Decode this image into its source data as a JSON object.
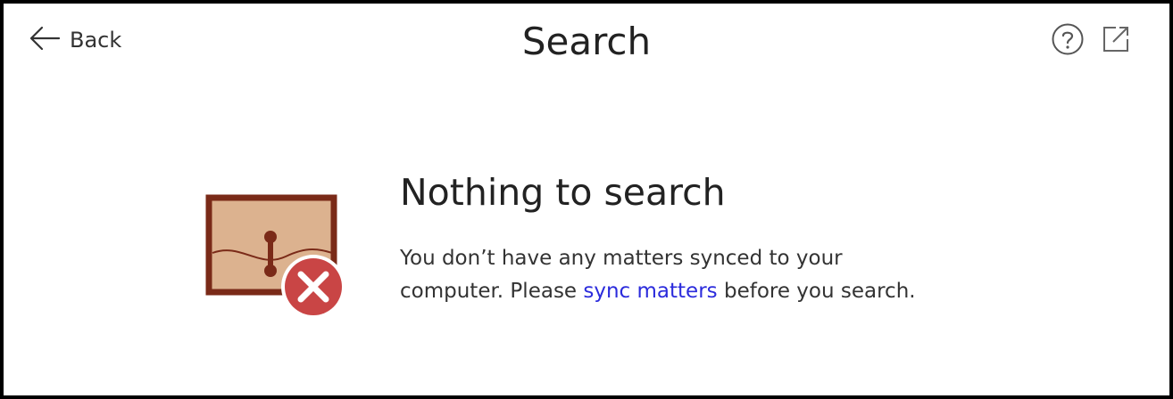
{
  "header": {
    "back_label": "Back",
    "title": "Search",
    "icons": [
      "help-icon",
      "open-external-icon"
    ]
  },
  "empty_state": {
    "heading": "Nothing to search",
    "message_line1": "You don’t have any matters synced to your",
    "message_line2_before": "computer. Please ",
    "link_text": "sync matters",
    "message_line2_after": " before you search.",
    "illustration": "briefcase-error-icon"
  },
  "colors": {
    "link": "#2b2bdc",
    "briefcase_border": "#7a2a18",
    "briefcase_fill": "#dcb28f",
    "error_badge": "#c94545"
  }
}
